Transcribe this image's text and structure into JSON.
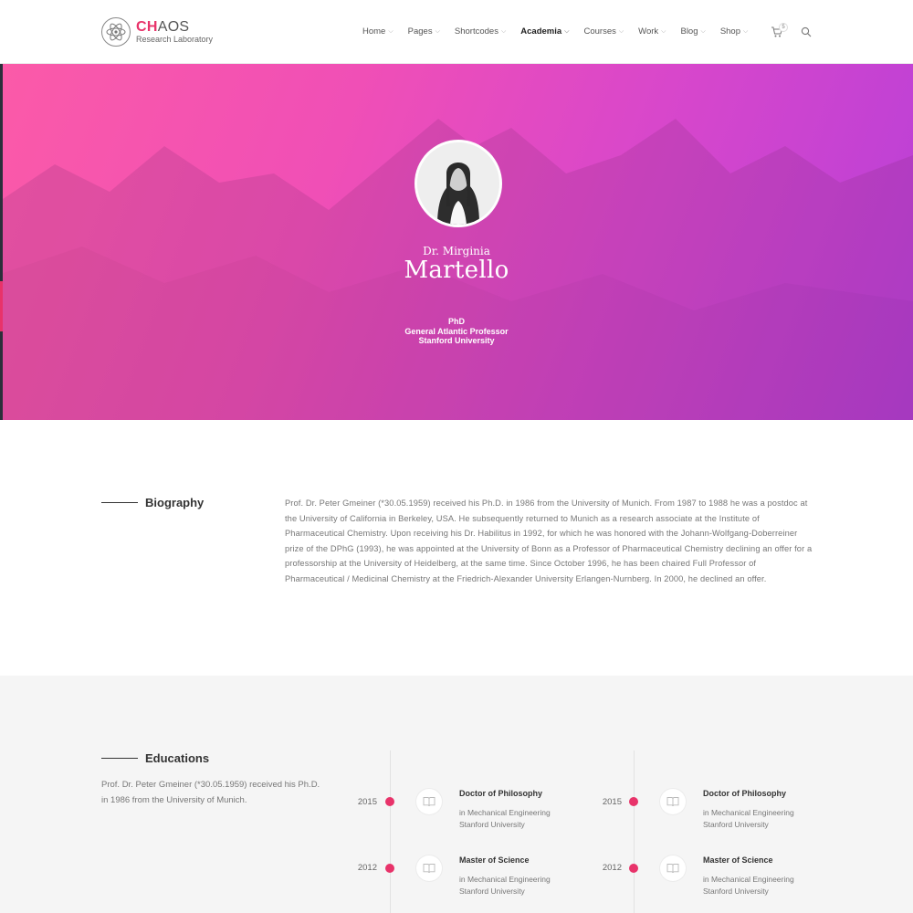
{
  "logo": {
    "name_accent": "CH",
    "name_rest": "AOS",
    "subtitle": "Research Laboratory"
  },
  "nav": [
    {
      "label": "Home",
      "active": false
    },
    {
      "label": "Pages",
      "active": false
    },
    {
      "label": "Shortcodes",
      "active": false
    },
    {
      "label": "Academia",
      "active": true
    },
    {
      "label": "Courses",
      "active": false
    },
    {
      "label": "Work",
      "active": false
    },
    {
      "label": "Blog",
      "active": false
    },
    {
      "label": "Shop",
      "active": false
    }
  ],
  "cart": {
    "count": "5"
  },
  "hero": {
    "prefix": "Dr. Mirginia",
    "surname": "Martello",
    "lines": [
      "PhD",
      "General Atlantic Professor",
      "Stanford University"
    ]
  },
  "biography": {
    "title": "Biography",
    "text": "Prof. Dr. Peter Gmeiner (*30.05.1959) received his Ph.D. in 1986 from the University of Munich. From 1987 to 1988 he was a postdoc at the University of California in Berkeley, USA. He subsequently returned to Munich as a research associate at the Institute of Pharmaceutical Chemistry. Upon receiving his Dr. Habilitus in 1992, for which he was honored with the Johann-Wolfgang-Doberreiner prize of the DPhG (1993), he was appointed at the University of Bonn as a Professor of Pharmaceutical Chemistry declining an offer for a professorship at the University of Heidelberg, at the same time. Since October 1996, he has been chaired Full Professor of Pharmaceutical / Medicinal Chemistry at the Friedrich-Alexander University Erlangen-Nurnberg. In 2000, he declined an offer."
  },
  "educations": {
    "title": "Educations",
    "intro": "Prof. Dr. Peter Gmeiner (*30.05.1959) received his Ph.D. in 1986 from the University of Munich.",
    "columns": [
      [
        {
          "year": "2015",
          "degree": "Doctor of Philosophy",
          "field": "in Mechanical Engineering",
          "school": "Stanford University"
        },
        {
          "year": "2012",
          "degree": "Master of Science",
          "field": "in Mechanical Engineering",
          "school": "Stanford University"
        }
      ],
      [
        {
          "year": "2015",
          "degree": "Doctor of Philosophy",
          "field": "in Mechanical Engineering",
          "school": "Stanford University"
        },
        {
          "year": "2012",
          "degree": "Master of Science",
          "field": "in Mechanical Engineering",
          "school": "Stanford University"
        }
      ]
    ]
  },
  "colors": {
    "accent": "#e8336a",
    "hero_start": "#fb5aa8",
    "hero_end": "#b73fd8"
  }
}
